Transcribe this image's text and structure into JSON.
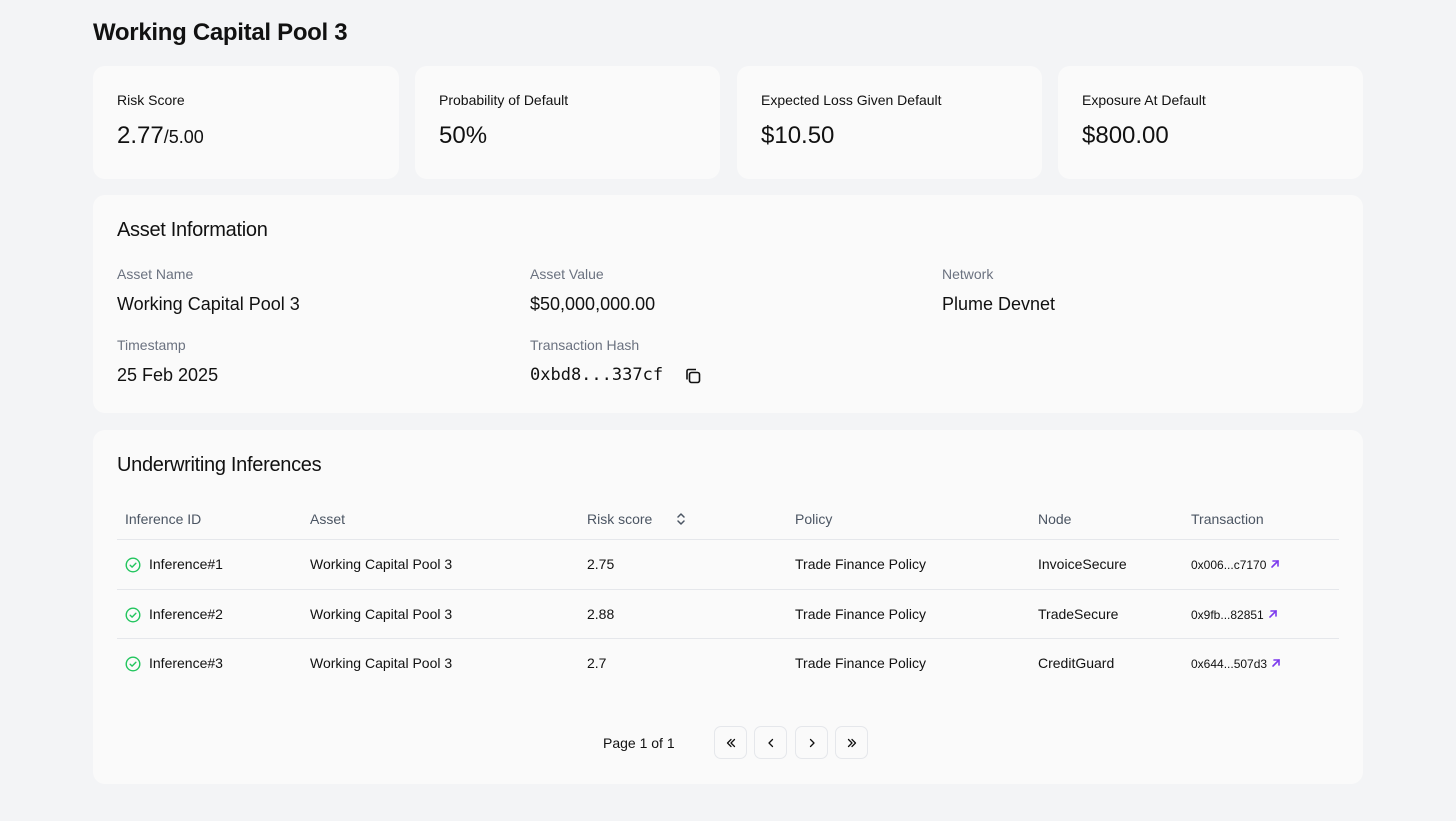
{
  "page": {
    "title": "Working Capital Pool 3"
  },
  "metrics": [
    {
      "label": "Risk Score",
      "value": "2.77",
      "suffix": "/5.00"
    },
    {
      "label": "Probability of Default",
      "value": "50%"
    },
    {
      "label": "Expected Loss Given Default",
      "value": "$10.50"
    },
    {
      "label": "Exposure At Default",
      "value": "$800.00"
    }
  ],
  "asset_info": {
    "title": "Asset Information",
    "fields": {
      "asset_name": {
        "label": "Asset Name",
        "value": "Working Capital Pool 3"
      },
      "asset_value": {
        "label": "Asset Value",
        "value": "$50,000,000.00"
      },
      "network": {
        "label": "Network",
        "value": "Plume Devnet"
      },
      "timestamp": {
        "label": "Timestamp",
        "value": "25 Feb 2025"
      },
      "tx_hash": {
        "label": "Transaction Hash",
        "value": "0xbd8...337cf"
      }
    }
  },
  "inferences": {
    "title": "Underwriting Inferences",
    "columns": [
      "Inference ID",
      "Asset",
      "Risk score",
      "Policy",
      "Node",
      "Transaction"
    ],
    "rows": [
      {
        "id": "Inference#1",
        "asset": "Working Capital Pool 3",
        "risk": "2.75",
        "policy": "Trade Finance Policy",
        "node": "InvoiceSecure",
        "tx": "0x006...c7170"
      },
      {
        "id": "Inference#2",
        "asset": "Working Capital Pool 3",
        "risk": "2.88",
        "policy": "Trade Finance Policy",
        "node": "TradeSecure",
        "tx": "0x9fb...82851"
      },
      {
        "id": "Inference#3",
        "asset": "Working Capital Pool 3",
        "risk": "2.7",
        "policy": "Trade Finance Policy",
        "node": "CreditGuard",
        "tx": "0x644...507d3"
      }
    ],
    "pagination": {
      "text": "Page 1 of 1"
    }
  },
  "colors": {
    "success": "#22c55e",
    "link_accent": "#7c3aed",
    "muted": "#6b7280"
  },
  "icons": {
    "status": "check-circle-icon",
    "tx_link": "external-link-icon",
    "copy": "copy-icon",
    "sort": "sort-icon"
  }
}
